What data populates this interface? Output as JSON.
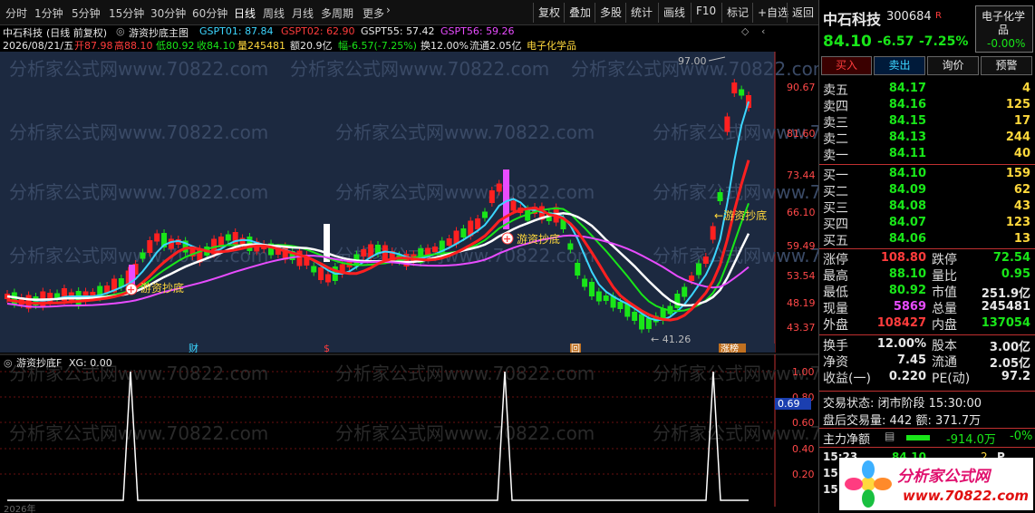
{
  "toolbar": {
    "periods": [
      "分时",
      "1分钟",
      "5分钟",
      "15分钟",
      "30分钟",
      "60分钟",
      "日线",
      "周线",
      "月线",
      "多周期",
      "更多"
    ],
    "active_period": "日线",
    "more_icon": "chevron-right-icon",
    "right": [
      "复权",
      "叠加",
      "多股",
      "统计",
      "画线",
      "F10",
      "标记",
      "+自选",
      "返回"
    ]
  },
  "header": {
    "stock": "中石科技",
    "mode": "(日线 前复权)",
    "indicator": "游资抄底主图",
    "gspt": [
      {
        "label": "GSPT01:",
        "value": "87.84",
        "color": "#3cd6ff"
      },
      {
        "label": "GSPT02:",
        "value": "62.90",
        "color": "#ff3c3c"
      },
      {
        "label": "GSPT55:",
        "value": "57.42",
        "color": "#e8e8e8"
      },
      {
        "label": "GSPT56:",
        "value": "59.26",
        "color": "#e84cff"
      }
    ]
  },
  "info": {
    "date": "2026/08/21/五",
    "open": "开87.98",
    "high": "高88.10",
    "low": "低80.92",
    "close": "收84.10",
    "vol": "量245481",
    "amt": "额20.9亿",
    "chg": "幅-6.57(-7.25%)",
    "turn": "换12.00%",
    "float": "流通2.05亿",
    "sector": "电子化学品"
  },
  "price_axis": [
    "90.67",
    "81.60",
    "73.44",
    "66.10",
    "59.49",
    "53.54",
    "48.19",
    "43.37"
  ],
  "annotations": {
    "high_mark": "97.00",
    "low_mark": "41.26",
    "signal": "游资抄底",
    "marker_cai": "财",
    "marker_dollar": "$",
    "marker_hui": "回",
    "marker_zt": "涨榜"
  },
  "watermark": "分析家公式网www.70822.com",
  "indicator_panel": {
    "title": "游资抄底F",
    "xg_label": "XG:",
    "xg_value": "0.00",
    "axis": [
      "1.00",
      "0.80",
      "0.60",
      "0.40",
      "0.20"
    ],
    "current": "0.69",
    "bottom_year": "2026年"
  },
  "quote": {
    "name": "中石科技",
    "code": "300684",
    "flag": "R",
    "sector_line1": "电子化学",
    "sector_line2": "品",
    "sector_chg": "-0.00%",
    "price": "84.10",
    "change": "-6.57",
    "pct": "-7.25%",
    "buttons": [
      "买入",
      "卖出",
      "询价",
      "预警"
    ],
    "sell": [
      {
        "label": "卖五",
        "price": "84.17",
        "vol": "4"
      },
      {
        "label": "卖四",
        "price": "84.16",
        "vol": "125"
      },
      {
        "label": "卖三",
        "price": "84.15",
        "vol": "17"
      },
      {
        "label": "卖二",
        "price": "84.13",
        "vol": "244"
      },
      {
        "label": "卖一",
        "price": "84.11",
        "vol": "40"
      }
    ],
    "buy": [
      {
        "label": "买一",
        "price": "84.10",
        "vol": "159"
      },
      {
        "label": "买二",
        "price": "84.09",
        "vol": "62"
      },
      {
        "label": "买三",
        "price": "84.08",
        "vol": "43"
      },
      {
        "label": "买四",
        "price": "84.07",
        "vol": "123"
      },
      {
        "label": "买五",
        "price": "84.06",
        "vol": "13"
      }
    ],
    "stats": [
      {
        "l1": "涨停",
        "v1": "108.80",
        "c1": "#ff3c3c",
        "l2": "跌停",
        "v2": "72.54",
        "c2": "#19e619"
      },
      {
        "l1": "最高",
        "v1": "88.10",
        "c1": "#19e619",
        "l2": "量比",
        "v2": "0.95",
        "c2": "#19e619"
      },
      {
        "l1": "最低",
        "v1": "80.92",
        "c1": "#19e619",
        "l2": "市值",
        "v2": "251.9亿",
        "c2": "#e8e8e8"
      },
      {
        "l1": "现量",
        "v1": "5869",
        "c1": "#e84cff",
        "l2": "总量",
        "v2": "245481",
        "c2": "#e8e8e8"
      },
      {
        "l1": "外盘",
        "v1": "108427",
        "c1": "#ff3c3c",
        "l2": "内盘",
        "v2": "137054",
        "c2": "#19e619"
      }
    ],
    "stats2": [
      {
        "l1": "换手",
        "v1": "12.00%",
        "l2": "股本",
        "v2": "3.00亿"
      },
      {
        "l1": "净资",
        "v1": "7.45",
        "l2": "流通",
        "v2": "2.05亿"
      },
      {
        "l1": "收益(一)",
        "v1": "0.220",
        "l2": "PE(动)",
        "v2": "97.2"
      }
    ],
    "trade_status": "交易状态: 闭市阶段 15:30:00",
    "after_hours": "盘后交易量: 442  额: 371.7万",
    "net_flow_label": "主力净额",
    "net_flow": "-914.0万",
    "net_flow_pct": "-0%",
    "ticks": [
      {
        "time": "15:23",
        "price": "84.10",
        "vol": "2",
        "flag": "P"
      },
      {
        "time": "15:15",
        "price": "",
        "vol": "",
        "flag": ""
      },
      {
        "time": "15:12",
        "price": "",
        "vol": "",
        "flag": ""
      }
    ],
    "logo_text": "分析家公式网",
    "logo_url": "www.70822.com"
  }
}
